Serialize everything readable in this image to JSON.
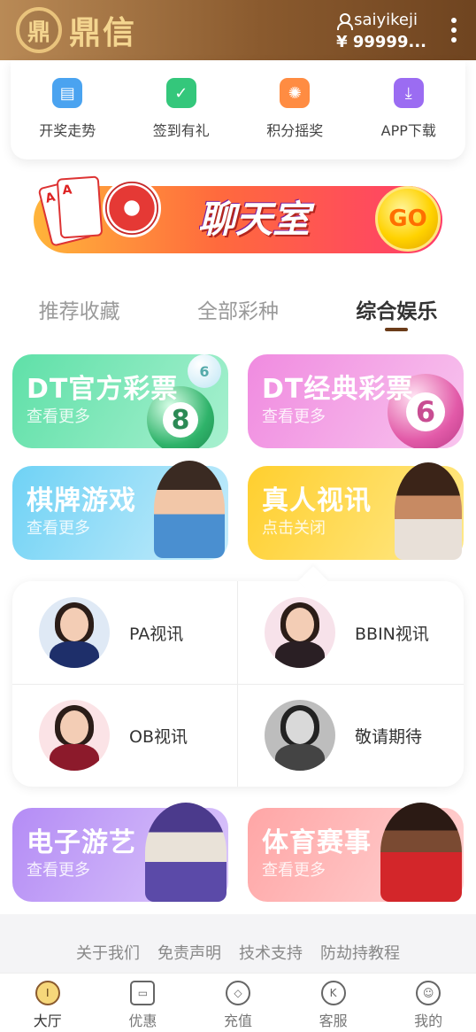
{
  "header": {
    "logo_mark": "鼎",
    "logo_text": "鼎信",
    "username": "saiyikeji",
    "balance": "¥ 99999..."
  },
  "quick_menu": [
    {
      "label": "开奖走势",
      "icon": "trend-chart-icon",
      "color": "#4aa3f0"
    },
    {
      "label": "签到有礼",
      "icon": "calendar-check-icon",
      "color": "#34c77b"
    },
    {
      "label": "积分摇奖",
      "icon": "lottery-wheel-icon",
      "color": "#ff8c42"
    },
    {
      "label": "APP下载",
      "icon": "download-icon",
      "color": "#9b6cf2"
    }
  ],
  "banner": {
    "title": "聊天室",
    "go": "GO"
  },
  "tabs": [
    {
      "label": "推荐收藏",
      "active": false
    },
    {
      "label": "全部彩种",
      "active": false
    },
    {
      "label": "综合娱乐",
      "active": true
    }
  ],
  "games": [
    {
      "title": "DT官方彩票",
      "sub": "查看更多",
      "ball": "8"
    },
    {
      "title": "DT经典彩票",
      "sub": "查看更多",
      "ball": "6"
    },
    {
      "title": "棋牌游戏",
      "sub": "查看更多"
    },
    {
      "title": "真人视讯",
      "sub": "点击关闭"
    },
    {
      "title": "电子游艺",
      "sub": "查看更多"
    },
    {
      "title": "体育赛事",
      "sub": "查看更多"
    }
  ],
  "live": [
    {
      "label": "PA视讯"
    },
    {
      "label": "BBIN视讯"
    },
    {
      "label": "OB视讯"
    },
    {
      "label": "敬请期待"
    }
  ],
  "footer_links": [
    "关于我们",
    "免责声明",
    "技术支持",
    "防劫持教程"
  ],
  "bottom_nav": [
    {
      "label": "大厅",
      "active": true
    },
    {
      "label": "优惠",
      "active": false
    },
    {
      "label": "充值",
      "active": false
    },
    {
      "label": "客服",
      "active": false
    },
    {
      "label": "我的",
      "active": false
    }
  ],
  "colors": {
    "header_brown": "#8a5a2e",
    "logo_gold": "#f4d58f",
    "tab_indicator": "#6b3c19"
  }
}
